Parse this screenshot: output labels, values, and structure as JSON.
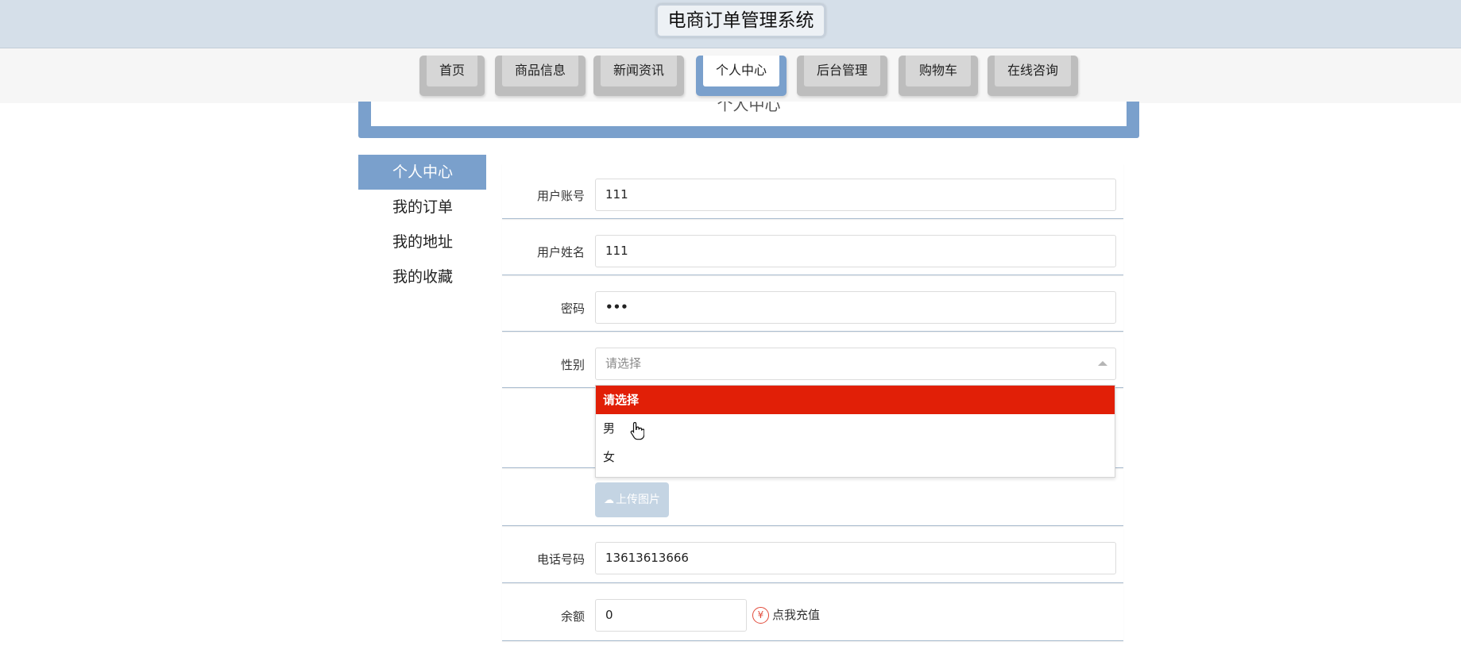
{
  "header": {
    "title": "电商订单管理系统"
  },
  "nav": {
    "items": [
      {
        "label": "首页"
      },
      {
        "label": "商品信息"
      },
      {
        "label": "新闻资讯"
      },
      {
        "label": "个人中心"
      },
      {
        "label": "后台管理"
      },
      {
        "label": "购物车"
      },
      {
        "label": "在线咨询"
      }
    ],
    "active": "个人中心"
  },
  "banner": {
    "title": "个人中心"
  },
  "sidebar": {
    "items": [
      {
        "label": "个人中心"
      },
      {
        "label": "我的订单"
      },
      {
        "label": "我的地址"
      },
      {
        "label": "我的收藏"
      }
    ],
    "active": "个人中心"
  },
  "form": {
    "account": {
      "label": "用户账号",
      "value": "111"
    },
    "name": {
      "label": "用户姓名",
      "value": "111"
    },
    "password": {
      "label": "密码",
      "value": "•••"
    },
    "gender": {
      "label": "性别",
      "placeholder": "请选择",
      "options": [
        "请选择",
        "男",
        "女"
      ],
      "highlighted": "请选择"
    },
    "upload": {
      "label": "上传图片"
    },
    "phone": {
      "label": "电话号码",
      "value": "13613613666"
    },
    "balance": {
      "label": "余额",
      "value": "0",
      "recharge_label": "点我充值"
    }
  },
  "colors": {
    "accent": "#7aa0cc",
    "header_bg": "#d5dfe9",
    "dropdown_highlight": "#e11f07",
    "upload_btn": "#c4d4e3",
    "recharge_icon": "#e24a3a"
  },
  "icons": {
    "upload": "cloud-upload-icon",
    "recharge": "yen-icon",
    "select": "caret-up-icon",
    "cursor": "hand-pointer-icon"
  }
}
